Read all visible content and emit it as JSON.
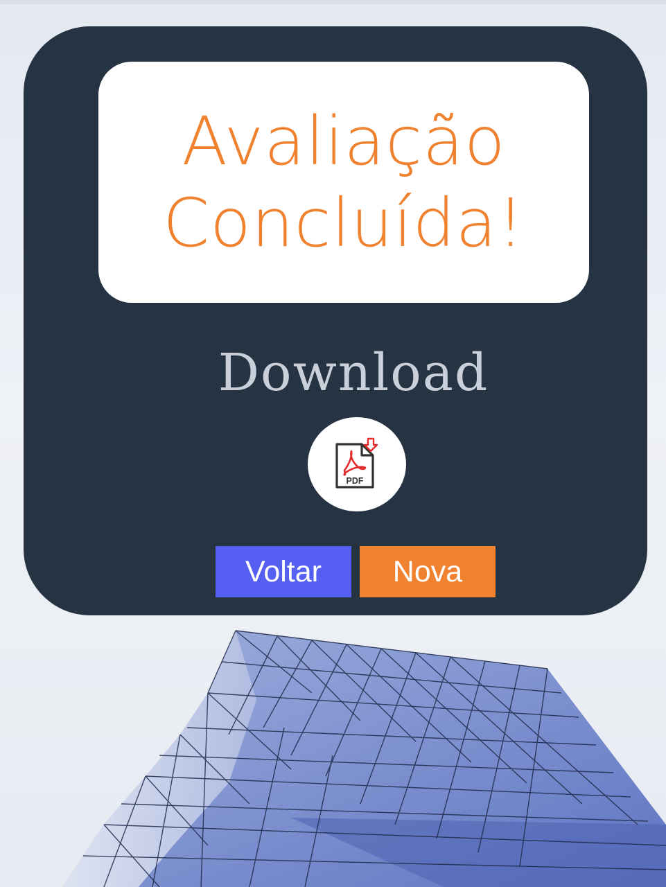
{
  "result": {
    "title_line_1": "Avaliação",
    "title_line_2": "Concluída!"
  },
  "download": {
    "label": "Download",
    "pdf_icon_text": "PDF",
    "icon": "pdf-download-icon"
  },
  "actions": {
    "back_label": "Voltar",
    "new_label": "Nova"
  },
  "colors": {
    "card_bg": "#263343",
    "accent_orange": "#f0812f",
    "accent_blue": "#5560f2",
    "pdf_red": "#e32b2b"
  }
}
